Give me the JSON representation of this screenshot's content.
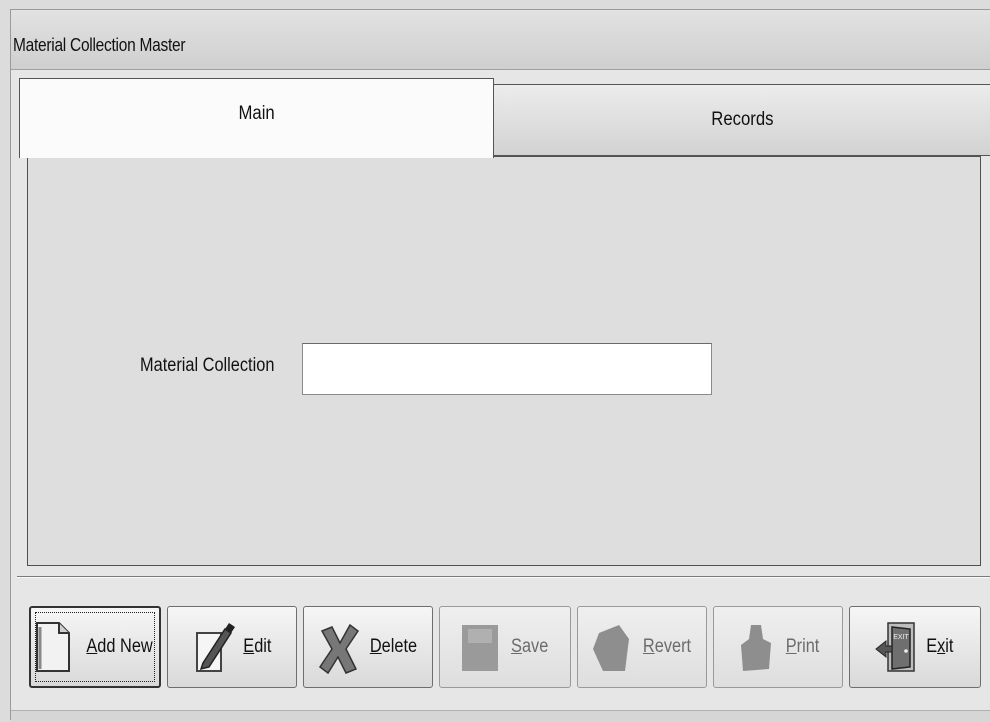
{
  "window": {
    "title": "Material Collection Master"
  },
  "tabs": [
    {
      "label": "Main",
      "active": true
    },
    {
      "label": "Records",
      "active": false
    }
  ],
  "form": {
    "material_collection_label": "Material Collection",
    "material_collection_value": ""
  },
  "toolbar": {
    "buttons": [
      {
        "key": "add_new",
        "hotkey": "A",
        "rest": "dd New",
        "icon": "add-new-document-icon",
        "enabled": true
      },
      {
        "key": "edit",
        "hotkey": "E",
        "rest": "dit",
        "icon": "edit-pen-icon",
        "enabled": true
      },
      {
        "key": "delete",
        "hotkey": "D",
        "rest": "elete",
        "icon": "delete-cross-icon",
        "enabled": true
      },
      {
        "key": "save",
        "hotkey": "S",
        "rest": "ave",
        "icon": "save-disk-icon",
        "enabled": false
      },
      {
        "key": "revert",
        "hotkey": "R",
        "rest": "evert",
        "icon": "revert-arrow-icon",
        "enabled": false
      },
      {
        "key": "print",
        "hotkey": "P",
        "rest": "rint",
        "icon": "print-printer-icon",
        "enabled": false
      },
      {
        "key": "exit",
        "hotkey": "",
        "rest": "",
        "prefix": "E",
        "hot": "x",
        "suffix": "it",
        "icon": "exit-door-icon",
        "enabled": true
      }
    ]
  },
  "colors": {
    "panel": "#dedede",
    "tab_active": "#fbfbfb",
    "button_face": "#e6e6e6"
  }
}
